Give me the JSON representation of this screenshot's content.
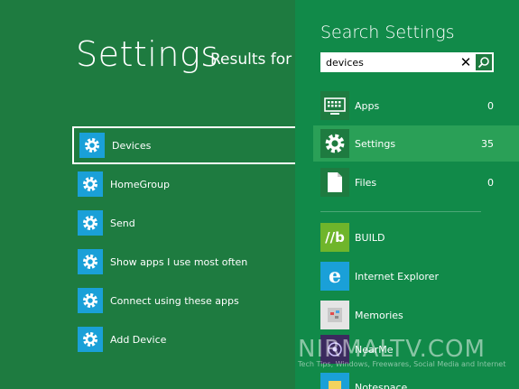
{
  "left": {
    "title": "Settings",
    "results_for": "Results for “",
    "results": [
      {
        "label": "Devices",
        "icon": "gear-icon"
      },
      {
        "label": "HomeGroup",
        "icon": "gear-icon"
      },
      {
        "label": "Send",
        "icon": "gear-icon"
      },
      {
        "label": "Show apps I use most often",
        "icon": "gear-icon"
      },
      {
        "label": "Connect using these apps",
        "icon": "gear-icon"
      },
      {
        "label": "Add Device",
        "icon": "gear-icon"
      }
    ]
  },
  "search": {
    "title": "Search Settings",
    "query": "devices",
    "clear_glyph": "✕",
    "scopes": [
      {
        "label": "Apps",
        "count": "0",
        "icon": "keyboard-icon"
      },
      {
        "label": "Settings",
        "count": "35",
        "icon": "gear-icon"
      },
      {
        "label": "Files",
        "count": "0",
        "icon": "file-icon"
      }
    ],
    "apps": [
      {
        "label": "BUILD",
        "icon": "build-icon",
        "glyph": "//b"
      },
      {
        "label": "Internet Explorer",
        "icon": "internet-explorer-icon",
        "glyph": "e"
      },
      {
        "label": "Memories",
        "icon": "memories-icon"
      },
      {
        "label": "NearMe",
        "icon": "nearme-icon"
      },
      {
        "label": "Notespace",
        "icon": "notespace-icon"
      }
    ]
  },
  "watermark": {
    "main": "NIRMALTV.COM",
    "sub": "Tech Tips, Windows, Freewares, Social Media and Internet"
  },
  "colors": {
    "left_bg": "#1e7b40",
    "right_bg": "#118a49",
    "active_scope": "#2aa057",
    "tile_blue": "#1aa0d8"
  }
}
